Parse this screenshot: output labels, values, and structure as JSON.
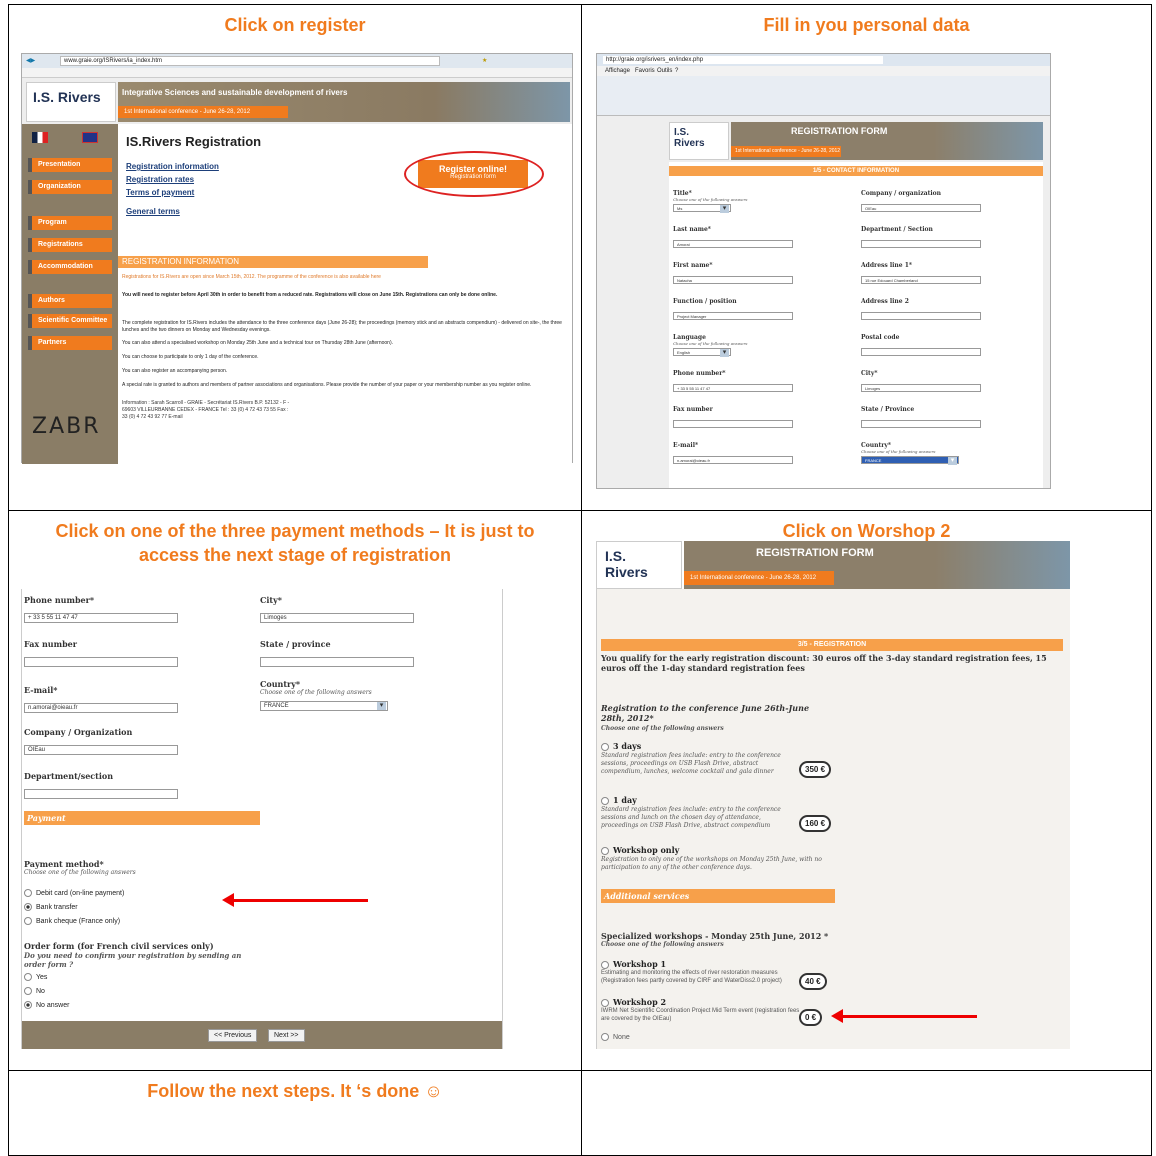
{
  "captions": {
    "c1": "Click on register",
    "c2": "Fill in you personal data",
    "c3": "Click on one of the three payment methods – It is just to access the next stage of registration",
    "c4": "Click on Worshop 2",
    "c5": "Follow the next steps. It ‘s done ☺"
  },
  "panel1": {
    "address": "www.graie.org/ISRivers/ia_index.htm",
    "banner_title": "Integrative Sciences and sustainable development of rivers",
    "banner_sub": "1st International conference - June 26-28, 2012",
    "logo_is": "I.S.",
    "logo_rivers": "Rivers",
    "page_title": "IS.Rivers Registration",
    "links": [
      "Registration information",
      "Registration rates",
      "Terms of payment",
      "General terms"
    ],
    "register_btn": "Register online!",
    "register_sub": "Registration form",
    "menu": [
      "Presentation",
      "Organization",
      "Program",
      "Registrations",
      "Accommodation",
      "Authors",
      "Scientific Committee",
      "Partners"
    ],
    "info_heading": "REGISTRATION INFORMATION",
    "info_intro": "Registrations for IS.Rivers are open since March 15th, 2012. The programme of the conference is also available here",
    "info_bold": "You will need to register before April 30th in order to benefit from a reduced rate. Registrations will close on June 15th. Registrations can only be done online.",
    "info_p1": "The complete registration for IS.Rivers includes the attendance to the three conference days (June 26-28); the proceedings (memory stick and an abstracts compendium) - delivered on site-, the three lunches and the two dinners on Monday and Wednesday evenings.",
    "info_p2": "You can also attend a specialised workshop on Monday 25th June and a technical tour on Thursday 28th June (afternoon).",
    "info_p3": "You can choose to participate to only 1 day of the conference.",
    "info_p4": "You can also register an accompanying person.",
    "info_p5": "A special rate is granted to authors and members of partner associations and organisations. Please provide the number of your paper or your membership number as you register online.",
    "contact": "Information : Sarah Scarroll - GRAIE - Secrétariat IS.Rivers B.P. 52132 - F - 69603 VILLEURBANNE CEDEX - FRANCE Tel : 33 (0) 4 72 43 73 55 Fax : 33 (0) 4 72 43 92 77 E-mail",
    "zabr": "ZABR"
  },
  "panel2": {
    "address": "http://graie.org/isrivers_en/index.php",
    "menu_items": [
      "Affichage",
      "Favoris",
      "Outils",
      "?"
    ],
    "form_title": "REGISTRATION FORM",
    "banner_sub": "1st International conference - June 26-28, 2012",
    "section": "1/5 - CONTACT INFORMATION",
    "left": [
      {
        "label": "Title*",
        "sub": "Choose one of the following answers",
        "value": "Ms",
        "kind": "select"
      },
      {
        "label": "Last name*",
        "sub": "",
        "value": "Amorai",
        "kind": "input"
      },
      {
        "label": "First name*",
        "sub": "",
        "value": "Natacha",
        "kind": "input"
      },
      {
        "label": "Function / position",
        "sub": "",
        "value": "Project Manager",
        "kind": "input"
      },
      {
        "label": "Language",
        "sub": "Choose one of the following answers",
        "value": "English",
        "kind": "select"
      },
      {
        "label": "Phone number*",
        "sub": "",
        "value": "+ 33 5 55 11 47 47",
        "kind": "input"
      },
      {
        "label": "Fax number",
        "sub": "",
        "value": "",
        "kind": "input"
      },
      {
        "label": "E-mail*",
        "sub": "",
        "value": "n.amorai@oieau.fr",
        "kind": "input"
      }
    ],
    "right": [
      {
        "label": "Company / organization",
        "sub": "",
        "value": "OIEau",
        "kind": "input"
      },
      {
        "label": "Department / Section",
        "sub": "",
        "value": "",
        "kind": "input"
      },
      {
        "label": "Address line 1*",
        "sub": "",
        "value": "15 rue Edouard Chamberland",
        "kind": "input"
      },
      {
        "label": "Address line 2",
        "sub": "",
        "value": "",
        "kind": "input"
      },
      {
        "label": "Postal code",
        "sub": "",
        "value": "",
        "kind": "input"
      },
      {
        "label": "City*",
        "sub": "",
        "value": "Limoges",
        "kind": "input"
      },
      {
        "label": "State / Province",
        "sub": "",
        "value": "",
        "kind": "input"
      },
      {
        "label": "Country*",
        "sub": "Choose one of the following answers",
        "value": "FRANCE",
        "kind": "select"
      }
    ]
  },
  "panel3": {
    "phone_label": "Phone number*",
    "phone_value": "+ 33 5 55 11 47 47",
    "city_label": "City*",
    "city_value": "Limoges",
    "fax_label": "Fax number",
    "state_label": "State / province",
    "email_label": "E-mail*",
    "email_value": "n.amorai@oieau.fr",
    "country_label": "Country*",
    "country_sub": "Choose one of the following answers",
    "country_value": "FRANCE",
    "company_label": "Company / Organization",
    "company_value": "OIEau",
    "dept_label": "Department/section",
    "payment_bar": "Payment",
    "method_label": "Payment method*",
    "method_sub": "Choose one of the following answers",
    "methods": [
      "Debit card (on-line payment)",
      "Bank transfer",
      "Bank cheque (France only)"
    ],
    "order_label": "Order form (for French civil services only)",
    "order_sub": "Do you need to confirm your registration by sending an order form ?",
    "order_opts": [
      "Yes",
      "No",
      "No answer"
    ],
    "prev": "<< Previous",
    "next": "Next >>"
  },
  "panel4": {
    "form_title": "REGISTRATION FORM",
    "banner_sub": "1st International conference - June 26-28, 2012",
    "section": "3/5 - REGISTRATION",
    "discount": "You qualify for the early registration discount: 30 euros off the 3-day standard registration fees, 15 euros off the 1-day standard registration fees",
    "reg_label": "Registration to the conference June 26th-June 28th, 2012*",
    "reg_sub": "Choose one of the following answers",
    "opt1_title": "3 days",
    "opt1_desc": "Standard registration fees include: entry to the conference sessions, proceedings on USB Flash Drive, abstract compendium, lunches, welcome cocktail and gala dinner",
    "opt1_price": "350 €",
    "opt2_title": "1 day",
    "opt2_desc": "Standard registration fees include: entry to the conference sessions and lunch on the chosen day of attendance, proceedings on USB Flash Drive, abstract compendium",
    "opt2_price": "160 €",
    "opt3_title": "Workshop only",
    "opt3_desc": "Registration to only one of the workshops on Monday 25th June, with no participation to any of the other conference days.",
    "additional": "Additional services",
    "ws_label": "Specialized workshops - Monday 25th June, 2012 *",
    "ws_sub": "Choose one of the following answers",
    "ws1_title": "Workshop 1",
    "ws1_desc": "Estimating and monitoring the effects of river restoration measures (Registration fees partly covered by CIRF and WaterDiss2.0 project)",
    "ws1_price": "40 €",
    "ws2_title": "Workshop 2",
    "ws2_desc": "IWRM Net Scientific Coordination Project Mid Term event (registration fees are covered by the OIEau)",
    "ws2_price": "0 €",
    "none": "None"
  }
}
